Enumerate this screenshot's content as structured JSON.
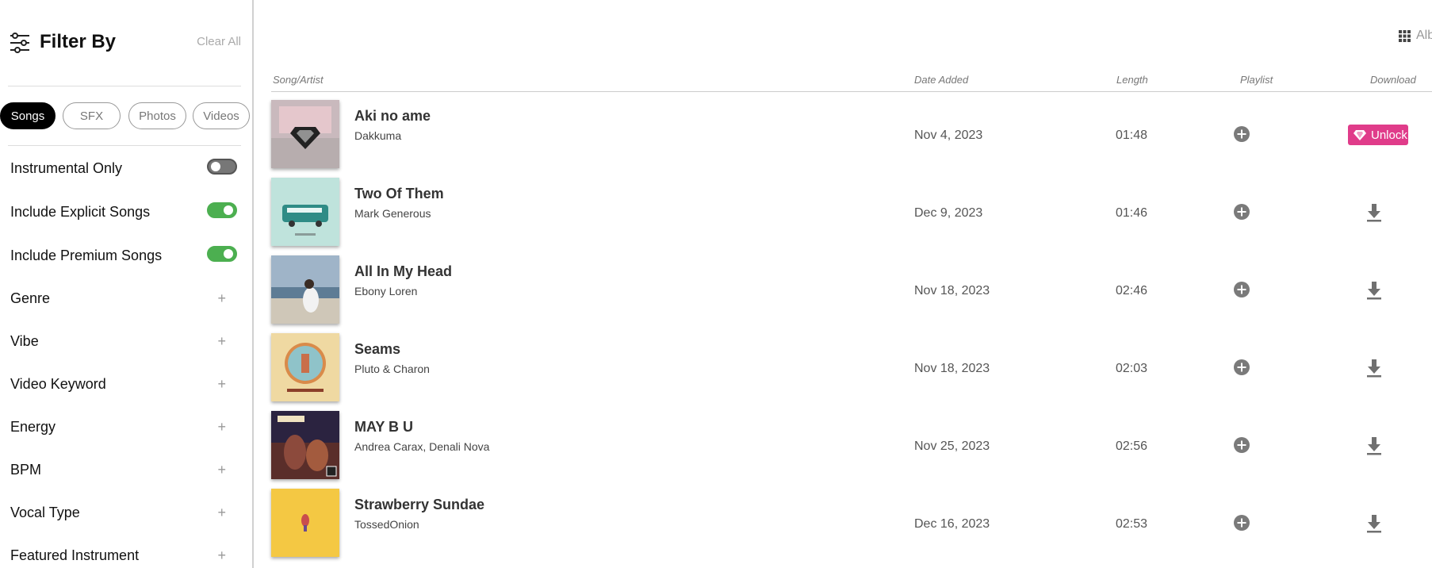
{
  "sidebar": {
    "title": "Filter By",
    "clear_all": "Clear All",
    "types": [
      "Songs",
      "SFX",
      "Photos",
      "Videos"
    ],
    "active_type": "Songs",
    "toggles": [
      {
        "label": "Instrumental Only",
        "on": false
      },
      {
        "label": "Include Explicit Songs",
        "on": true
      },
      {
        "label": "Include Premium Songs",
        "on": true
      }
    ],
    "facets": [
      "Genre",
      "Vibe",
      "Video Keyword",
      "Energy",
      "BPM",
      "Vocal Type",
      "Featured Instrument"
    ],
    "facet_icon": "+"
  },
  "view": {
    "label": "Alb",
    "icon": "grid-icon"
  },
  "table": {
    "headers": {
      "song": "Song/Artist",
      "date": "Date Added",
      "length": "Length",
      "playlist": "Playlist",
      "download": "Download"
    },
    "unlock_label": "Unlock",
    "rows": [
      {
        "title": "Aki no ame",
        "artist": "Dakkuma",
        "date": "Nov 4, 2023",
        "length": "01:48",
        "action": "unlock"
      },
      {
        "title": "Two Of Them",
        "artist": "Mark Generous",
        "date": "Dec 9, 2023",
        "length": "01:46",
        "action": "download"
      },
      {
        "title": "All In My Head",
        "artist": "Ebony Loren",
        "date": "Nov 18, 2023",
        "length": "02:46",
        "action": "download"
      },
      {
        "title": "Seams",
        "artist": "Pluto & Charon",
        "date": "Nov 18, 2023",
        "length": "02:03",
        "action": "download"
      },
      {
        "title": "MAY B U",
        "artist": "Andrea Carax, Denali Nova",
        "date": "Nov 25, 2023",
        "length": "02:56",
        "action": "download"
      },
      {
        "title": "Strawberry Sundae",
        "artist": "TossedOnion",
        "date": "Dec 16, 2023",
        "length": "02:53",
        "action": "download"
      }
    ]
  },
  "colors": {
    "accent": "#e03c8a",
    "toggle_on": "#4caf50",
    "toggle_off": "#777777"
  }
}
